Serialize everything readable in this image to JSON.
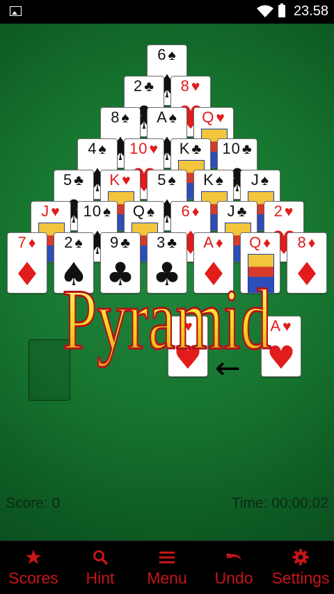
{
  "status_bar": {
    "time": "23.58",
    "icons": [
      "image-notification-icon",
      "wifi-icon",
      "battery-charging-icon"
    ]
  },
  "game": {
    "title_overlay": "Pyramid",
    "score_text": "Score: 0",
    "time_text": "Time: 00:00:02",
    "colors": {
      "felt": "#16742f",
      "red_suit": "#e21b1b",
      "black_suit": "#111111",
      "title_fill": "#f7e12c",
      "title_outline": "#b3121a"
    },
    "pyramid": [
      {
        "row": 1,
        "cards": [
          {
            "rank": "6",
            "suit": "♠",
            "color": "black"
          }
        ]
      },
      {
        "row": 2,
        "cards": [
          {
            "rank": "2",
            "suit": "♣",
            "color": "black"
          },
          {
            "rank": "8",
            "suit": "♥",
            "color": "red"
          }
        ]
      },
      {
        "row": 3,
        "cards": [
          {
            "rank": "8",
            "suit": "♠",
            "color": "black"
          },
          {
            "rank": "A",
            "suit": "♠",
            "color": "black"
          },
          {
            "rank": "Q",
            "suit": "♥",
            "color": "red"
          }
        ]
      },
      {
        "row": 4,
        "cards": [
          {
            "rank": "4",
            "suit": "♠",
            "color": "black"
          },
          {
            "rank": "10",
            "suit": "♥",
            "color": "red"
          },
          {
            "rank": "K",
            "suit": "♣",
            "color": "black"
          },
          {
            "rank": "10",
            "suit": "♣",
            "color": "black"
          }
        ]
      },
      {
        "row": 5,
        "cards": [
          {
            "rank": "5",
            "suit": "♣",
            "color": "black"
          },
          {
            "rank": "K",
            "suit": "♥",
            "color": "red"
          },
          {
            "rank": "5",
            "suit": "♠",
            "color": "black"
          },
          {
            "rank": "K",
            "suit": "♠",
            "color": "black"
          },
          {
            "rank": "J",
            "suit": "♠",
            "color": "black"
          }
        ]
      },
      {
        "row": 6,
        "cards": [
          {
            "rank": "J",
            "suit": "♥",
            "color": "red"
          },
          {
            "rank": "10",
            "suit": "♠",
            "color": "black"
          },
          {
            "rank": "Q",
            "suit": "♠",
            "color": "black"
          },
          {
            "rank": "6",
            "suit": "♦",
            "color": "red"
          },
          {
            "rank": "J",
            "suit": "♣",
            "color": "black"
          },
          {
            "rank": "2",
            "suit": "♥",
            "color": "red"
          }
        ]
      },
      {
        "row": 7,
        "cards": [
          {
            "rank": "7",
            "suit": "♦",
            "color": "red"
          },
          {
            "rank": "2",
            "suit": "♠",
            "color": "black"
          },
          {
            "rank": "9",
            "suit": "♣",
            "color": "black"
          },
          {
            "rank": "3",
            "suit": "♣",
            "color": "black"
          },
          {
            "rank": "A",
            "suit": "♦",
            "color": "red"
          },
          {
            "rank": "Q",
            "suit": "♦",
            "color": "red"
          },
          {
            "rank": "8",
            "suit": "♦",
            "color": "red"
          }
        ]
      }
    ],
    "waste_card": {
      "rank": "",
      "suit": "♥",
      "color": "red"
    },
    "foundation_card": {
      "rank": "A",
      "suit": "♥",
      "color": "red"
    }
  },
  "bottom_bar": {
    "items": [
      {
        "label": "Scores",
        "icon": "star-icon"
      },
      {
        "label": "Hint",
        "icon": "search-icon"
      },
      {
        "label": "Menu",
        "icon": "menu-icon"
      },
      {
        "label": "Undo",
        "icon": "undo-icon"
      },
      {
        "label": "Settings",
        "icon": "gear-icon"
      }
    ]
  }
}
